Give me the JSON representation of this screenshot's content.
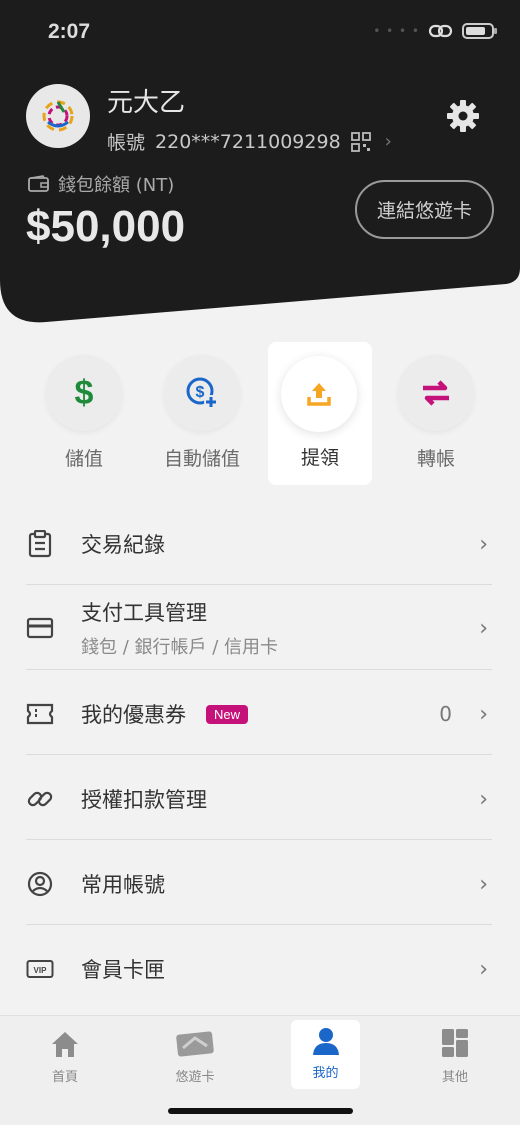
{
  "status": {
    "time": "2:07"
  },
  "profile": {
    "name": "元大乙",
    "account_label": "帳號",
    "account_number": "220***7211009298"
  },
  "wallet": {
    "label": "錢包餘額 (NT)",
    "balance": "$50,000",
    "link_card_button": "連結悠遊卡"
  },
  "actions": [
    {
      "label": "儲值",
      "icon": "dollar-icon",
      "color": "#1f8a3a"
    },
    {
      "label": "自動儲值",
      "icon": "auto-topup-icon",
      "color": "#1a66c9"
    },
    {
      "label": "提領",
      "icon": "upload-icon",
      "color": "#f5a623"
    },
    {
      "label": "轉帳",
      "icon": "transfer-icon",
      "color": "#c4127a"
    }
  ],
  "menu": [
    {
      "title": "交易紀錄",
      "icon": "clipboard-icon"
    },
    {
      "title": "支付工具管理",
      "subtitle": "錢包 / 銀行帳戶 / 信用卡",
      "icon": "card-icon"
    },
    {
      "title": "我的優惠券",
      "badge": "New",
      "count": "0",
      "icon": "coupon-icon"
    },
    {
      "title": "授權扣款管理",
      "icon": "link-icon"
    },
    {
      "title": "常用帳號",
      "icon": "user-circle-icon"
    },
    {
      "title": "會員卡匣",
      "icon": "vip-icon"
    }
  ],
  "tabs": [
    {
      "label": "首頁",
      "icon": "home-icon"
    },
    {
      "label": "悠遊卡",
      "icon": "easycard-icon"
    },
    {
      "label": "我的",
      "icon": "person-icon",
      "active": true
    },
    {
      "label": "其他",
      "icon": "grid-icon"
    }
  ],
  "colors": {
    "header_bg": "#1c1c1c",
    "accent_blue": "#1a66c9",
    "badge_pink": "#c4127a"
  }
}
